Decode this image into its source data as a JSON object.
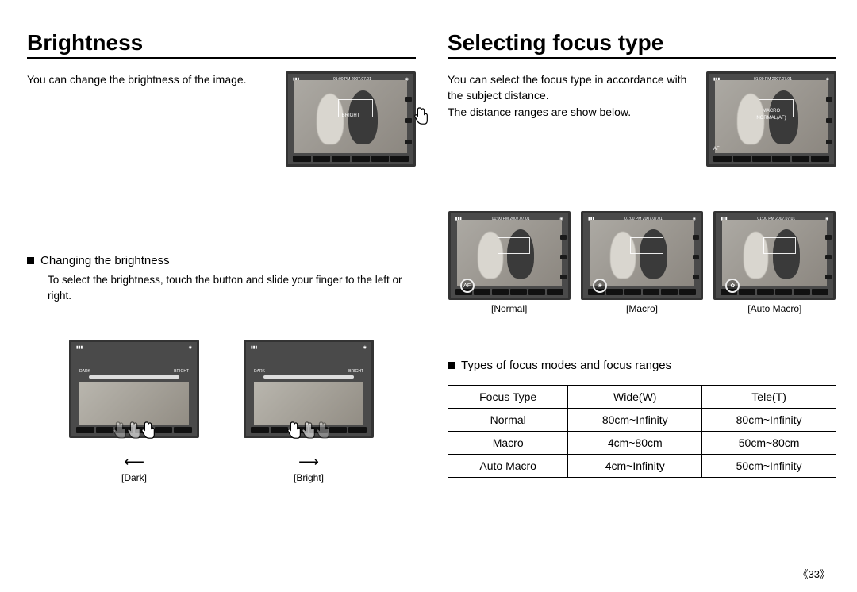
{
  "left": {
    "title": "Brightness",
    "intro": "You can change the brightness of the image.",
    "lcd_label": "BRIGHT",
    "lcd_topbar": "01:00 PM 2007.07.01",
    "subhead": "Changing the brightness",
    "subtext": "To select the brightness, touch the button and slide your finger to the left or right.",
    "slider_dark": "DARK",
    "slider_bright": "BRIGHT",
    "thumb1_caption": "[Dark]",
    "thumb2_caption": "[Bright]"
  },
  "right": {
    "title": "Selecting focus type",
    "intro": "You can select the focus type in accordance with the subject distance.\nThe distance ranges are show below.",
    "lcd_label_top": "MACRO",
    "lcd_label_bottom": "NORMAL(AF)",
    "lcd_topbar": "01:00 PM 2007.07.01",
    "thumbs": {
      "normal": {
        "caption": "[Normal]",
        "icon": "AF"
      },
      "macro": {
        "caption": "[Macro]",
        "icon": "❀"
      },
      "automacro": {
        "caption": "[Auto Macro]",
        "icon": "✿"
      }
    },
    "subhead": "Types of focus modes and focus ranges",
    "table": {
      "headers": [
        "Focus Type",
        "Wide(W)",
        "Tele(T)"
      ],
      "rows": [
        [
          "Normal",
          "80cm~Infinity",
          "80cm~Infinity"
        ],
        [
          "Macro",
          "4cm~80cm",
          "50cm~80cm"
        ],
        [
          "Auto Macro",
          "4cm~Infinity",
          "50cm~Infinity"
        ]
      ]
    }
  },
  "page_number": "《33》"
}
